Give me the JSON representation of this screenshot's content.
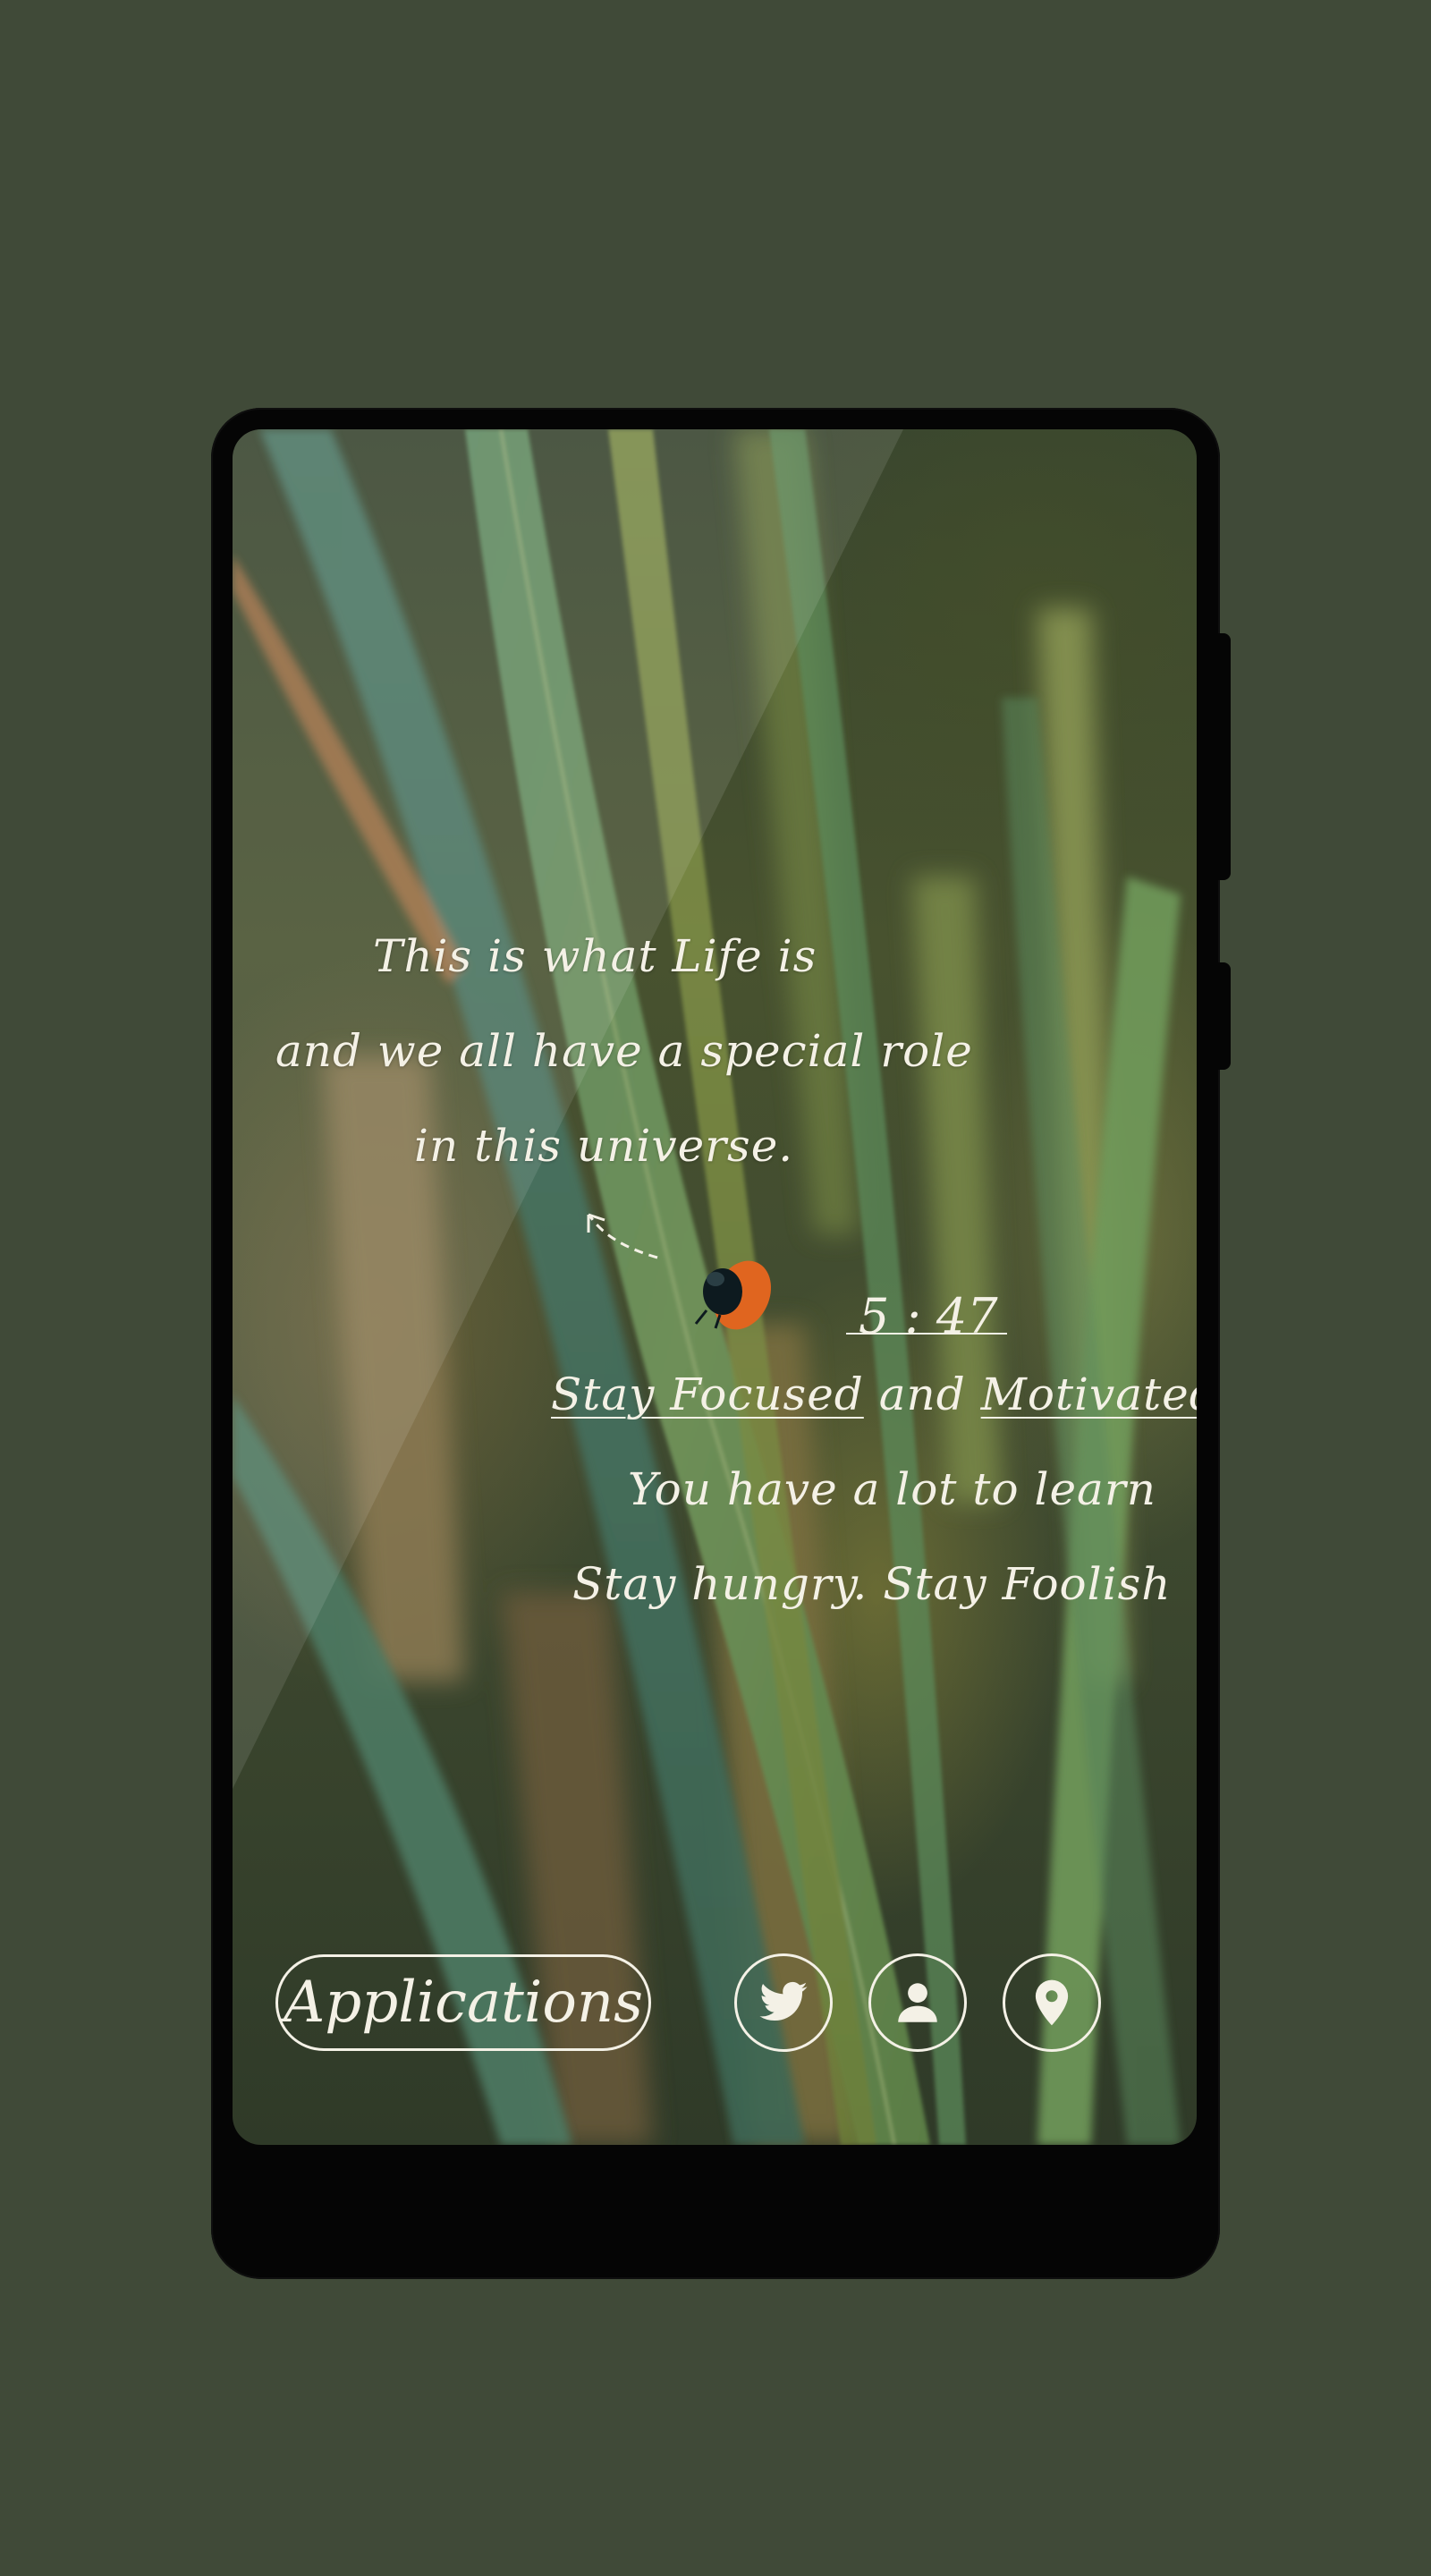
{
  "quote": {
    "line1": "This is what Life is",
    "line2": "and we all have a special role",
    "line3": "in this universe."
  },
  "clock": {
    "time": "5 : 47"
  },
  "motivation": {
    "focused": "Stay Focused",
    "and": " and ",
    "motivated": "Motivated",
    "line2": "You have a lot to learn",
    "line3": "Stay hungry. Stay Foolish"
  },
  "dock": {
    "applications_label": "Applications",
    "icons": [
      "twitter-icon",
      "user-icon",
      "location-pin-icon"
    ]
  },
  "colors": {
    "background": "#404a38",
    "phone_frame": "#050505",
    "text": "#f4f1e6"
  }
}
